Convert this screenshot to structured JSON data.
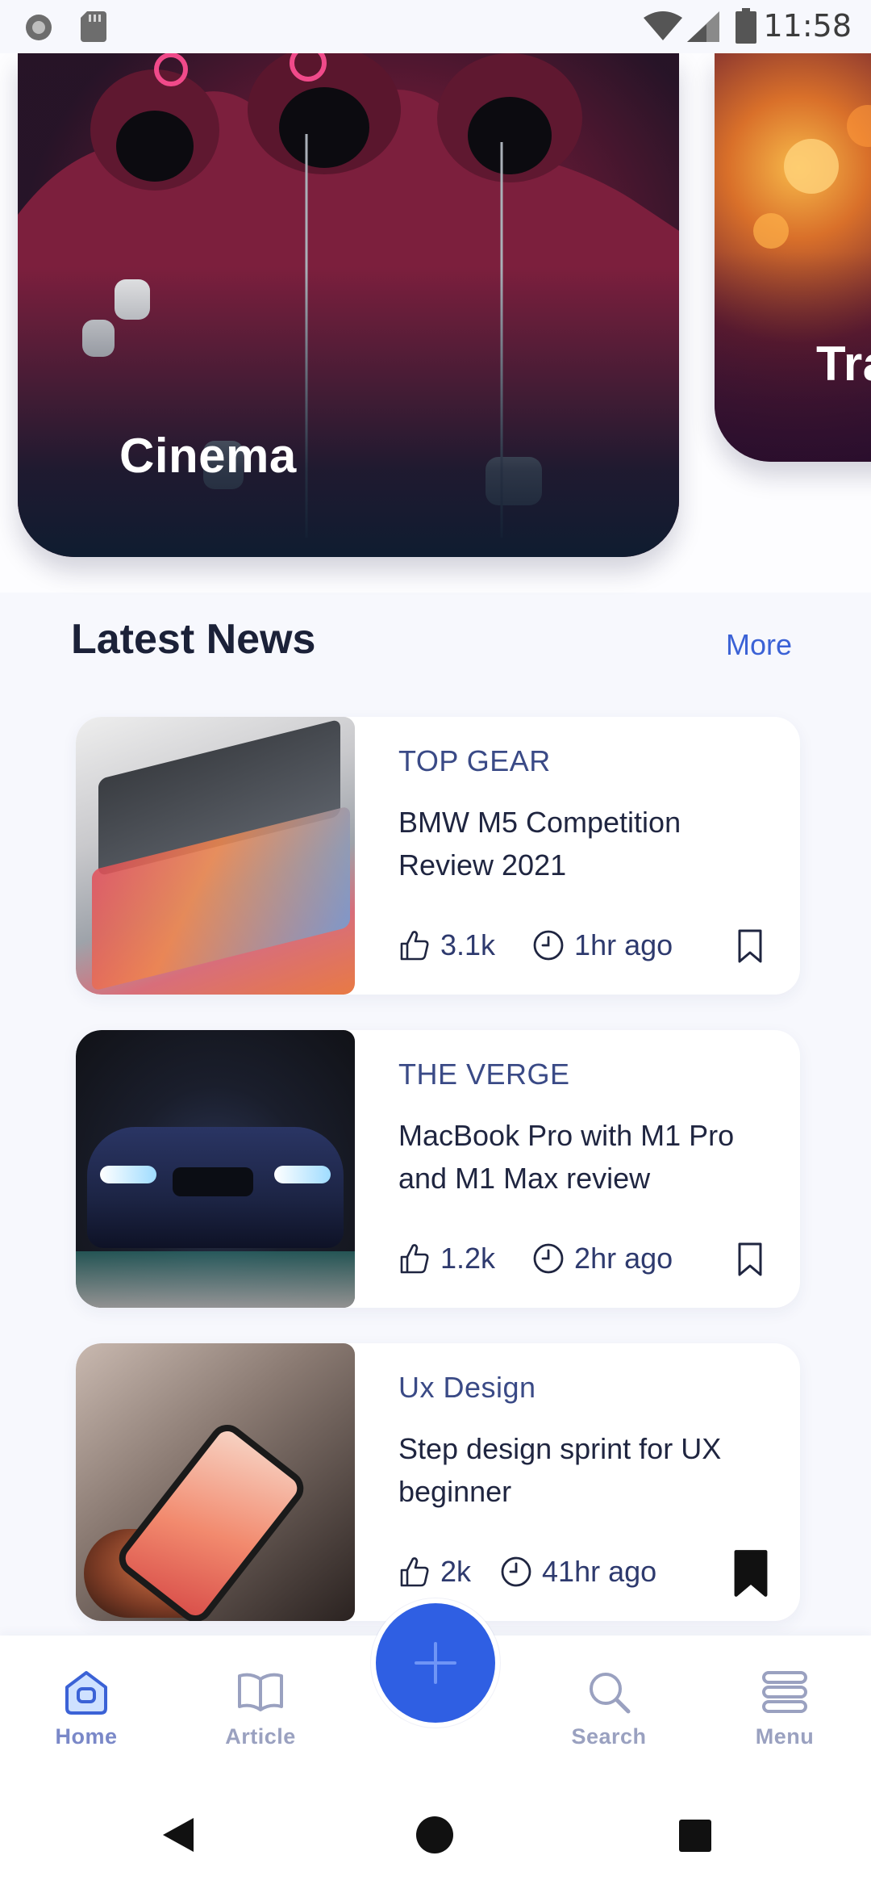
{
  "status_bar": {
    "time": "11:58"
  },
  "hero_cards": [
    {
      "title": "Cinema"
    },
    {
      "title": "Tra"
    }
  ],
  "latest_news": {
    "title": "Latest News",
    "more_label": "More",
    "items": [
      {
        "source": "TOP GEAR",
        "title": "BMW M5 Competition Review 2021",
        "likes": "3.1k",
        "time": "1hr ago",
        "bookmarked": false
      },
      {
        "source": "THE VERGE",
        "title": "MacBook Pro with M1 Pro and M1 Max review",
        "likes": "1.2k",
        "time": "2hr ago",
        "bookmarked": false
      },
      {
        "source": "Ux Design",
        "title": "Step design sprint for UX beginner",
        "likes": "2k",
        "time": "41hr ago",
        "bookmarked": true
      }
    ]
  },
  "bottom_nav": {
    "home_label": "Home",
    "article_label": "Article",
    "search_label": "Search",
    "menu_label": "Menu",
    "active": "Home"
  },
  "colors": {
    "accent": "#2f5fe3",
    "link": "#3b62d6",
    "heading": "#1b2138",
    "nav_inactive": "#9aa1c0"
  },
  "icons": {
    "like": "thumbs-up-icon",
    "time": "clock-icon",
    "bookmark": "bookmark-icon",
    "fab": "plus-icon"
  }
}
